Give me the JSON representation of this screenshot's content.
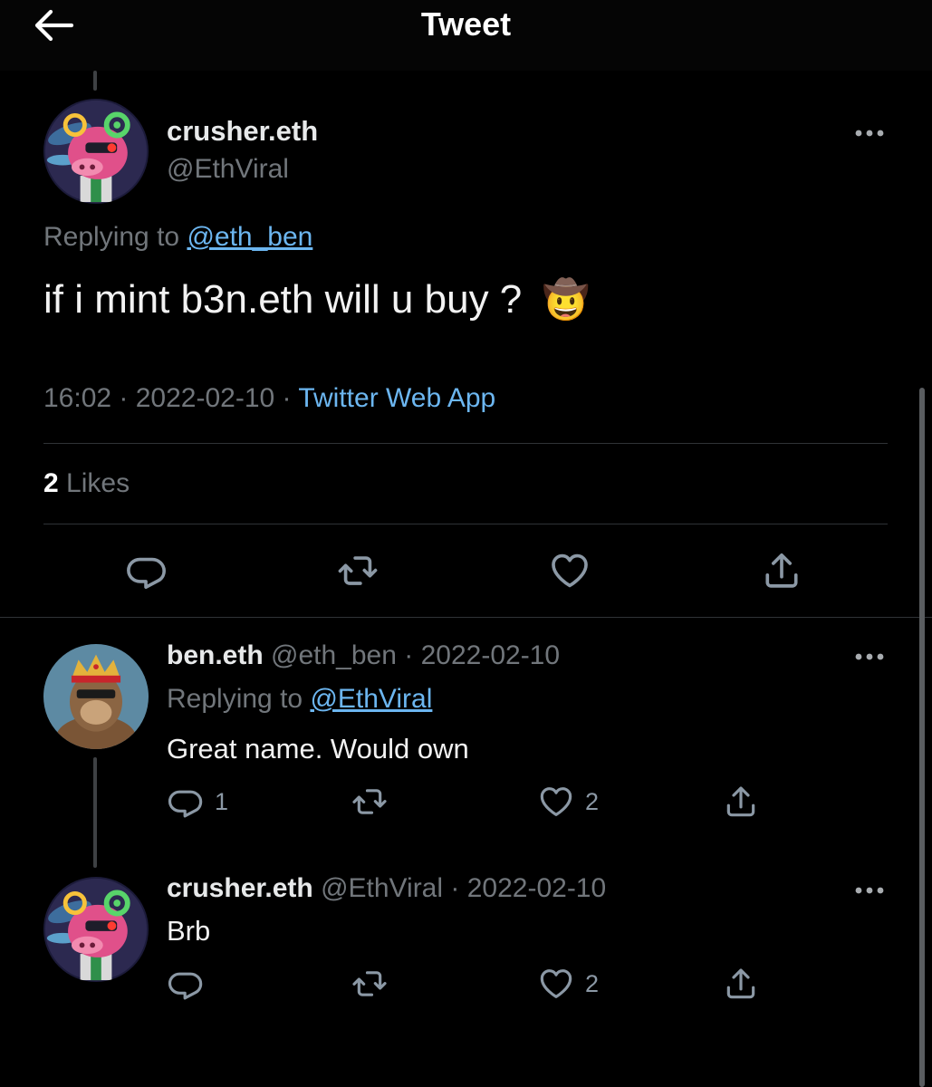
{
  "header": {
    "title": "Tweet"
  },
  "main_tweet": {
    "display_name": "crusher.eth",
    "handle": "@EthViral",
    "replying_prefix": "Replying to",
    "replying_to": "@eth_ben",
    "text": "if i mint b3n.eth will u buy ?",
    "emoji": "🤠",
    "time": "16:02",
    "separator": " · ",
    "date": "2022-02-10",
    "source": "Twitter Web App",
    "likes_count": "2",
    "likes_label": "Likes"
  },
  "replies": [
    {
      "display_name": "ben.eth",
      "handle": "@eth_ben",
      "date_sep": " · ",
      "date": "2022-02-10",
      "replying_prefix": "Replying to",
      "replying_to": "@EthViral",
      "text": "Great name. Would own",
      "reply_count": "1",
      "like_count": "2"
    },
    {
      "display_name": "crusher.eth",
      "handle": "@EthViral",
      "date_sep": " · ",
      "date": "2022-02-10",
      "text": "Brb",
      "like_count": "2"
    }
  ],
  "icons": {
    "back": "arrow-left-icon",
    "more": "more-horizontal-icon",
    "reply": "reply-icon",
    "retweet": "retweet-icon",
    "like": "heart-icon",
    "share": "share-icon"
  },
  "colors": {
    "background": "#000000",
    "link": "#6cb6f0",
    "muted": "#71767b",
    "text": "#e7e9ea"
  }
}
